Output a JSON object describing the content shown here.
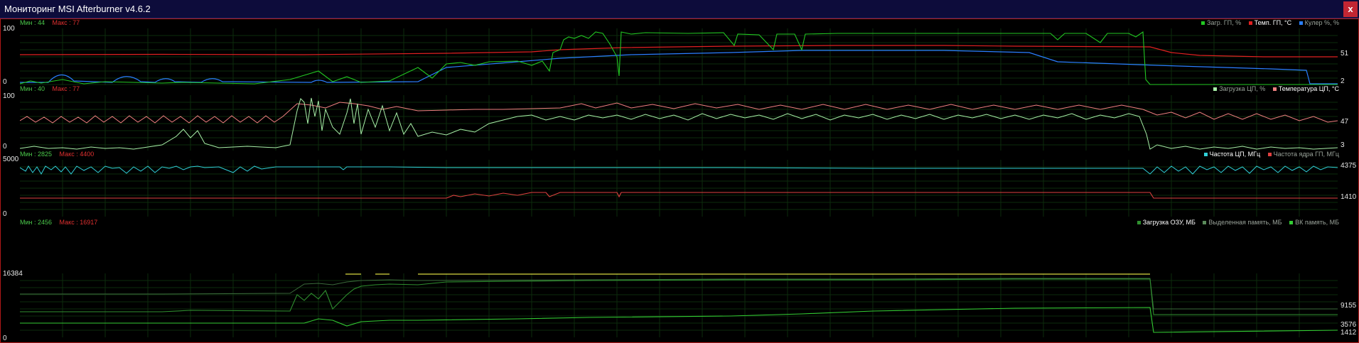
{
  "window": {
    "title": "Мониторинг MSI Afterburner v4.6.2",
    "close_label": "x"
  },
  "colors": {
    "frame_border": "#b01818",
    "grid": "#0d2b0d",
    "min_label": "#4ac84a",
    "max_label": "#e03030"
  },
  "panels": [
    {
      "min_label": "Мин : 44",
      "max_label": "Макс : 77",
      "y_top": "100",
      "y_bottom": "0",
      "legend": [
        {
          "label": "Загр. ГП, %",
          "color": "#22c822",
          "selected": false
        },
        {
          "label": "Темп. ГП, °С",
          "color": "#e02020",
          "selected": true
        },
        {
          "label": "Кулер %, %",
          "color": "#2a7fff",
          "selected": false
        }
      ],
      "right_values": [
        "51",
        "2"
      ]
    },
    {
      "min_label": "Мин : 40",
      "max_label": "Макс : 77",
      "y_top": "100",
      "y_bottom": "0",
      "legend": [
        {
          "label": "Загрузка ЦП, %",
          "color": "#a8f0a8",
          "selected": false
        },
        {
          "label": "Температура ЦП, °С",
          "color": "#f08080",
          "selected": true
        }
      ],
      "right_values": [
        "47",
        "3"
      ]
    },
    {
      "min_label": "Мин : 2825",
      "max_label": "Макс : 4400",
      "y_top": "5000",
      "y_bottom": "0",
      "legend": [
        {
          "label": "Частота ЦП, МГц",
          "color": "#30d0d8",
          "selected": true
        },
        {
          "label": "Частота ядра ГП, МГц",
          "color": "#e04040",
          "selected": false
        }
      ],
      "right_values": [
        "4375",
        "1410"
      ]
    },
    {
      "min_label": "Мин : 2456",
      "max_label": "Макс : 16917",
      "y_top": "16384",
      "y_bottom": "0",
      "legend": [
        {
          "label": "Загрузка ОЗУ, МБ",
          "color": "#2f8f2f",
          "selected": true
        },
        {
          "label": "Выделенная память, МБ",
          "color": "#5a8a5a",
          "selected": false
        },
        {
          "label": "ВК память, МБ",
          "color": "#33cc33",
          "selected": false
        }
      ],
      "right_values": [
        "9155",
        "3576",
        "1412"
      ]
    }
  ]
}
